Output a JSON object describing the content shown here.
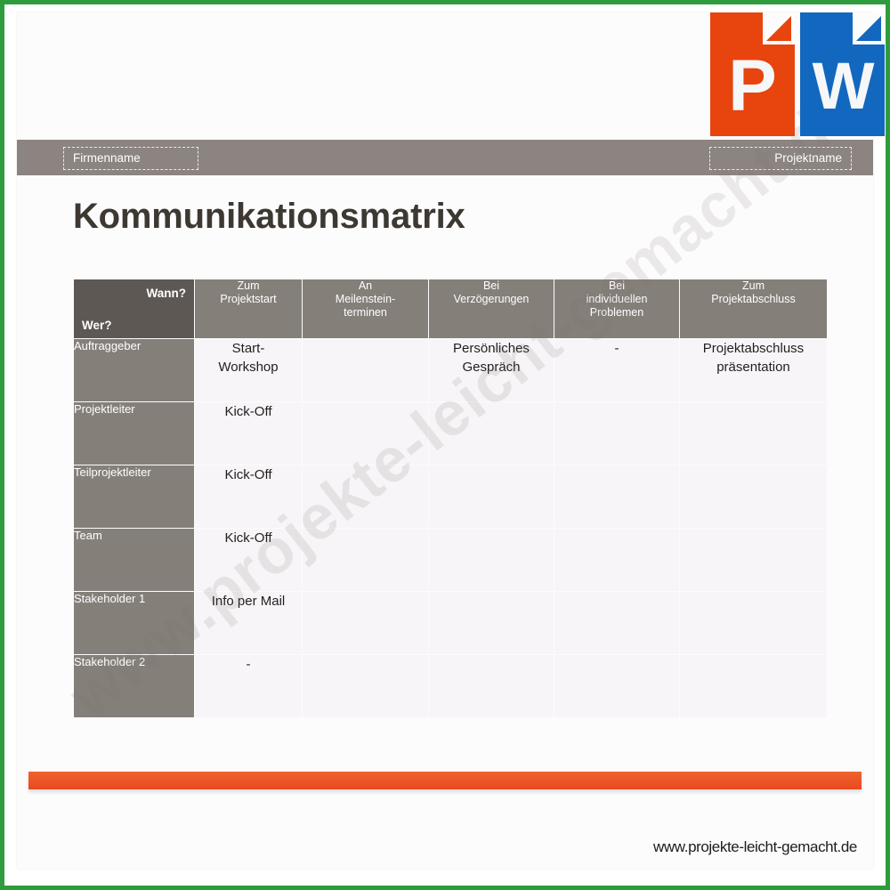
{
  "document": {
    "title": "Kommunikationsmatrix",
    "watermark": "www.projekte-leicht-gemacht.de",
    "footer_url": "www.projekte-leicht-gemacht.de"
  },
  "header": {
    "company_placeholder": "Firmenname",
    "project_placeholder": "Projektname"
  },
  "icons": {
    "powerpoint_letter": "P",
    "word_letter": "W"
  },
  "matrix": {
    "corner": {
      "column_axis_label": "Wann?",
      "row_axis_label": "Wer?"
    },
    "columns": [
      "Zum Projektstart",
      "An Meilenstein- terminen",
      "Bei Verzögerungen",
      "Bei individuellen Problemen",
      "Zum Projektabschluss"
    ],
    "columns_lines": [
      [
        "Zum",
        "Projektstart"
      ],
      [
        "An",
        "Meilenstein-",
        "terminen"
      ],
      [
        "Bei",
        "Verzögerungen"
      ],
      [
        "Bei",
        "individuellen",
        "Problemen"
      ],
      [
        "Zum",
        "Projektabschluss"
      ]
    ],
    "rows": [
      {
        "role": "Auftraggeber",
        "cells": [
          "Start-\nWorkshop",
          "",
          "Persönliches\nGespräch",
          "-",
          "Projektabschluss\npräsentation"
        ]
      },
      {
        "role": "Projektleiter",
        "cells": [
          "Kick-Off",
          "",
          "",
          "",
          ""
        ]
      },
      {
        "role": "Teilprojektleiter",
        "cells": [
          "Kick-Off",
          "",
          "",
          "",
          ""
        ]
      },
      {
        "role": "Team",
        "cells": [
          "Kick-Off",
          "",
          "",
          "",
          ""
        ]
      },
      {
        "role": "Stakeholder 1",
        "cells": [
          "Info per Mail",
          "",
          "",
          "",
          ""
        ]
      },
      {
        "role": "Stakeholder 2",
        "cells": [
          "-",
          "",
          "",
          "",
          ""
        ]
      }
    ]
  },
  "colors": {
    "frame_green": "#2e9b3c",
    "header_bar_gray": "#8b8480",
    "corner_dark_gray": "#5d5853",
    "table_header_gray": "#857f7a",
    "cell_bg": "#f7f5f7",
    "accent_orange": "#e8491e",
    "powerpoint_orange": "#e8440e",
    "word_blue": "#1268be",
    "title_color": "#3d3831"
  }
}
